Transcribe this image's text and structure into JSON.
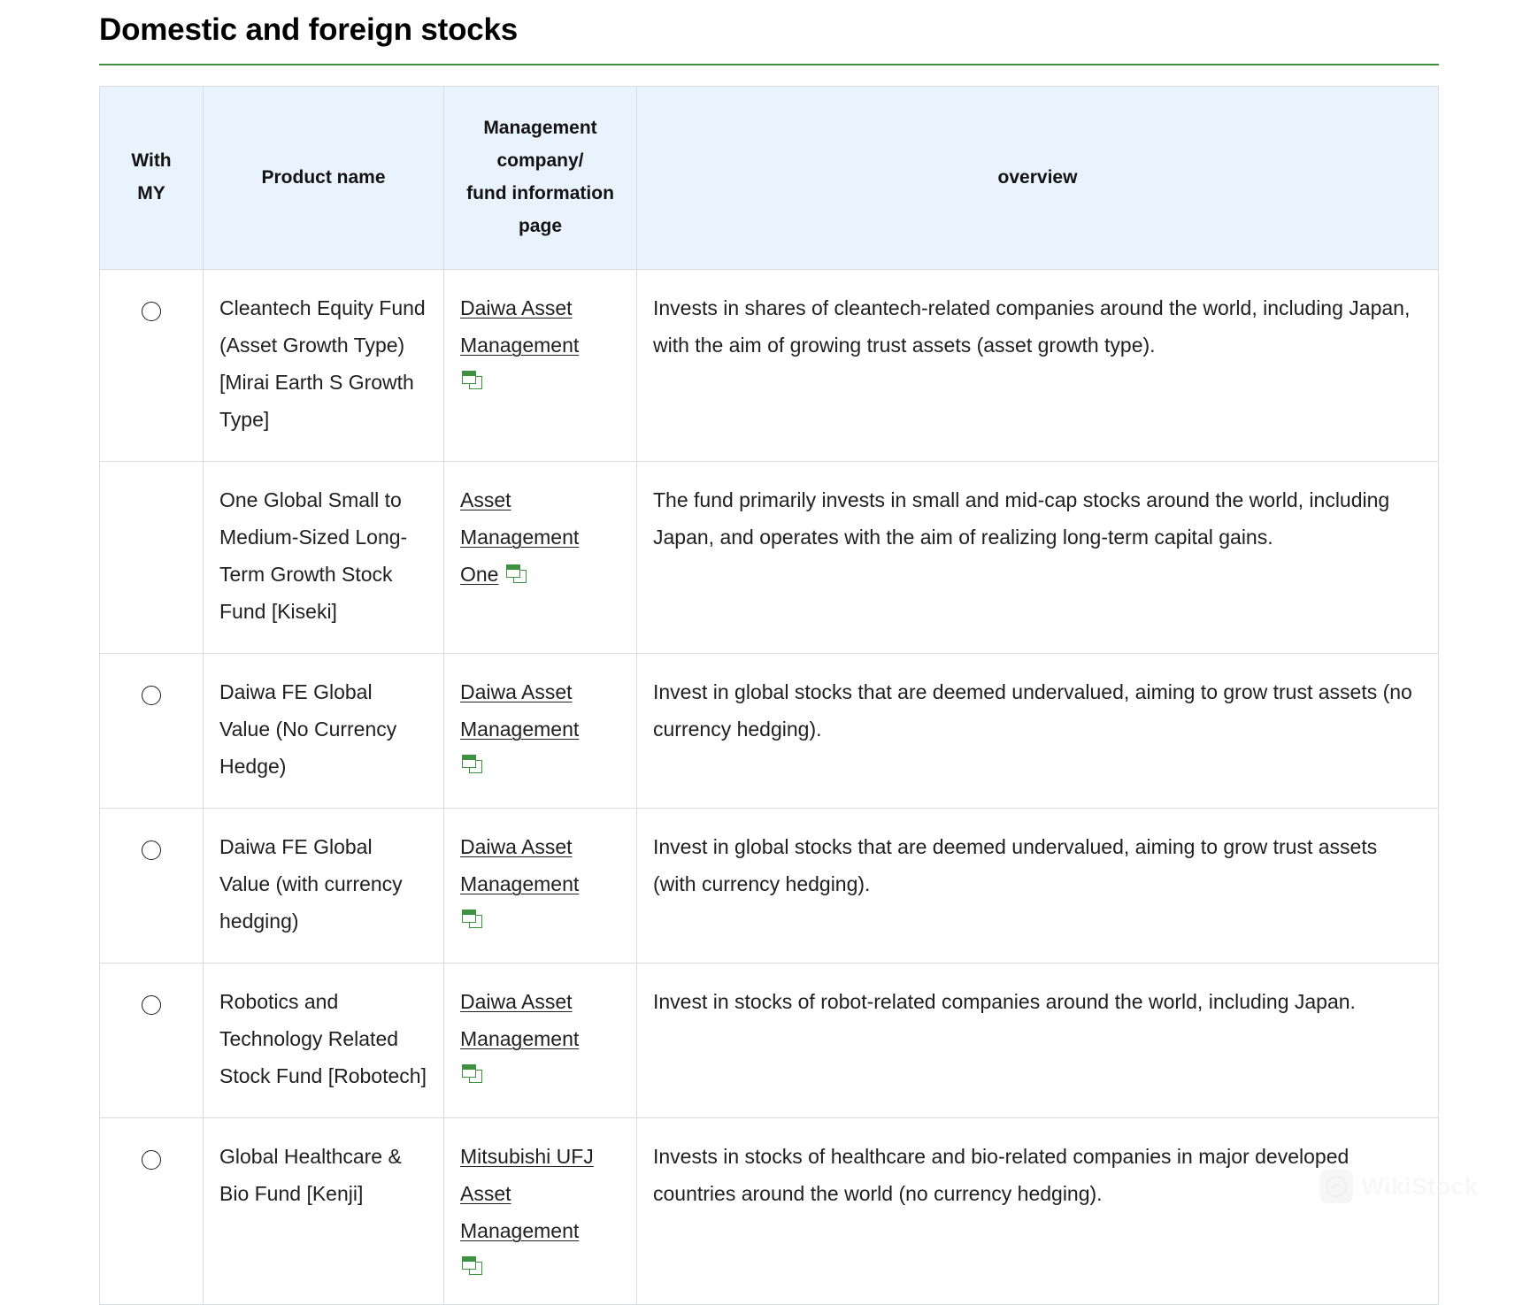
{
  "page": {
    "title": "Domestic and foreign stocks"
  },
  "table": {
    "headers": {
      "with_my": "With\nMY",
      "with_my_line1": "With",
      "with_my_line2": "MY",
      "product_name": "Product name",
      "company_line1": "Management",
      "company_line2": "company/",
      "company_line3": "fund information",
      "company_line4": "page",
      "overview": "overview"
    },
    "rows": [
      {
        "with_my": "circle",
        "product_name": "Cleantech Equity Fund (Asset Growth Type) [Mirai Earth S Growth Type]",
        "company": "Daiwa Asset Management",
        "company_icon": "external-window-icon",
        "icon_inline": false,
        "overview": "Invests in shares of cleantech-related companies around the world, including Japan, with the aim of growing trust assets (asset growth type)."
      },
      {
        "with_my": "",
        "product_name": "One Global Small to Medium-Sized Long-Term Growth Stock Fund [Kiseki]",
        "company": "Asset Management One",
        "company_icon": "external-window-icon",
        "icon_inline": true,
        "overview": "The fund primarily invests in small and mid-cap stocks around the world, including Japan, and operates with the aim of realizing long-term capital gains."
      },
      {
        "with_my": "circle",
        "product_name": "Daiwa FE Global Value (No Currency Hedge)",
        "company": "Daiwa Asset Management",
        "company_icon": "external-window-icon",
        "icon_inline": false,
        "overview": "Invest in global stocks that are deemed undervalued, aiming to grow trust assets (no currency hedging)."
      },
      {
        "with_my": "circle",
        "product_name": "Daiwa FE Global Value (with currency hedging)",
        "company": "Daiwa Asset Management",
        "company_icon": "external-window-icon",
        "icon_inline": false,
        "overview": "Invest in global stocks that are deemed undervalued, aiming to grow trust assets (with currency hedging)."
      },
      {
        "with_my": "circle",
        "product_name": "Robotics and Technology Related Stock Fund [Robotech]",
        "company": "Daiwa Asset Management",
        "company_icon": "external-window-icon",
        "icon_inline": false,
        "overview": "Invest in stocks of robot-related companies around the world, including Japan."
      },
      {
        "with_my": "circle",
        "product_name": "Global Healthcare & Bio Fund [Kenji]",
        "company": "Mitsubishi UFJ Asset Management",
        "company_icon": "external-window-icon",
        "icon_inline": false,
        "overview": "Invests in stocks of healthcare and bio-related companies in major developed countries around the world (no currency hedging)."
      }
    ]
  },
  "watermark": {
    "text": "WikiStock",
    "logo_icon": "wikistock-logo-icon"
  },
  "colors": {
    "header_background": "#e9f3fd",
    "title_rule": "#3f8f3f",
    "link_icon_green": "#3f9142",
    "border": "#d9dde2",
    "text": "#1f1f1f"
  }
}
